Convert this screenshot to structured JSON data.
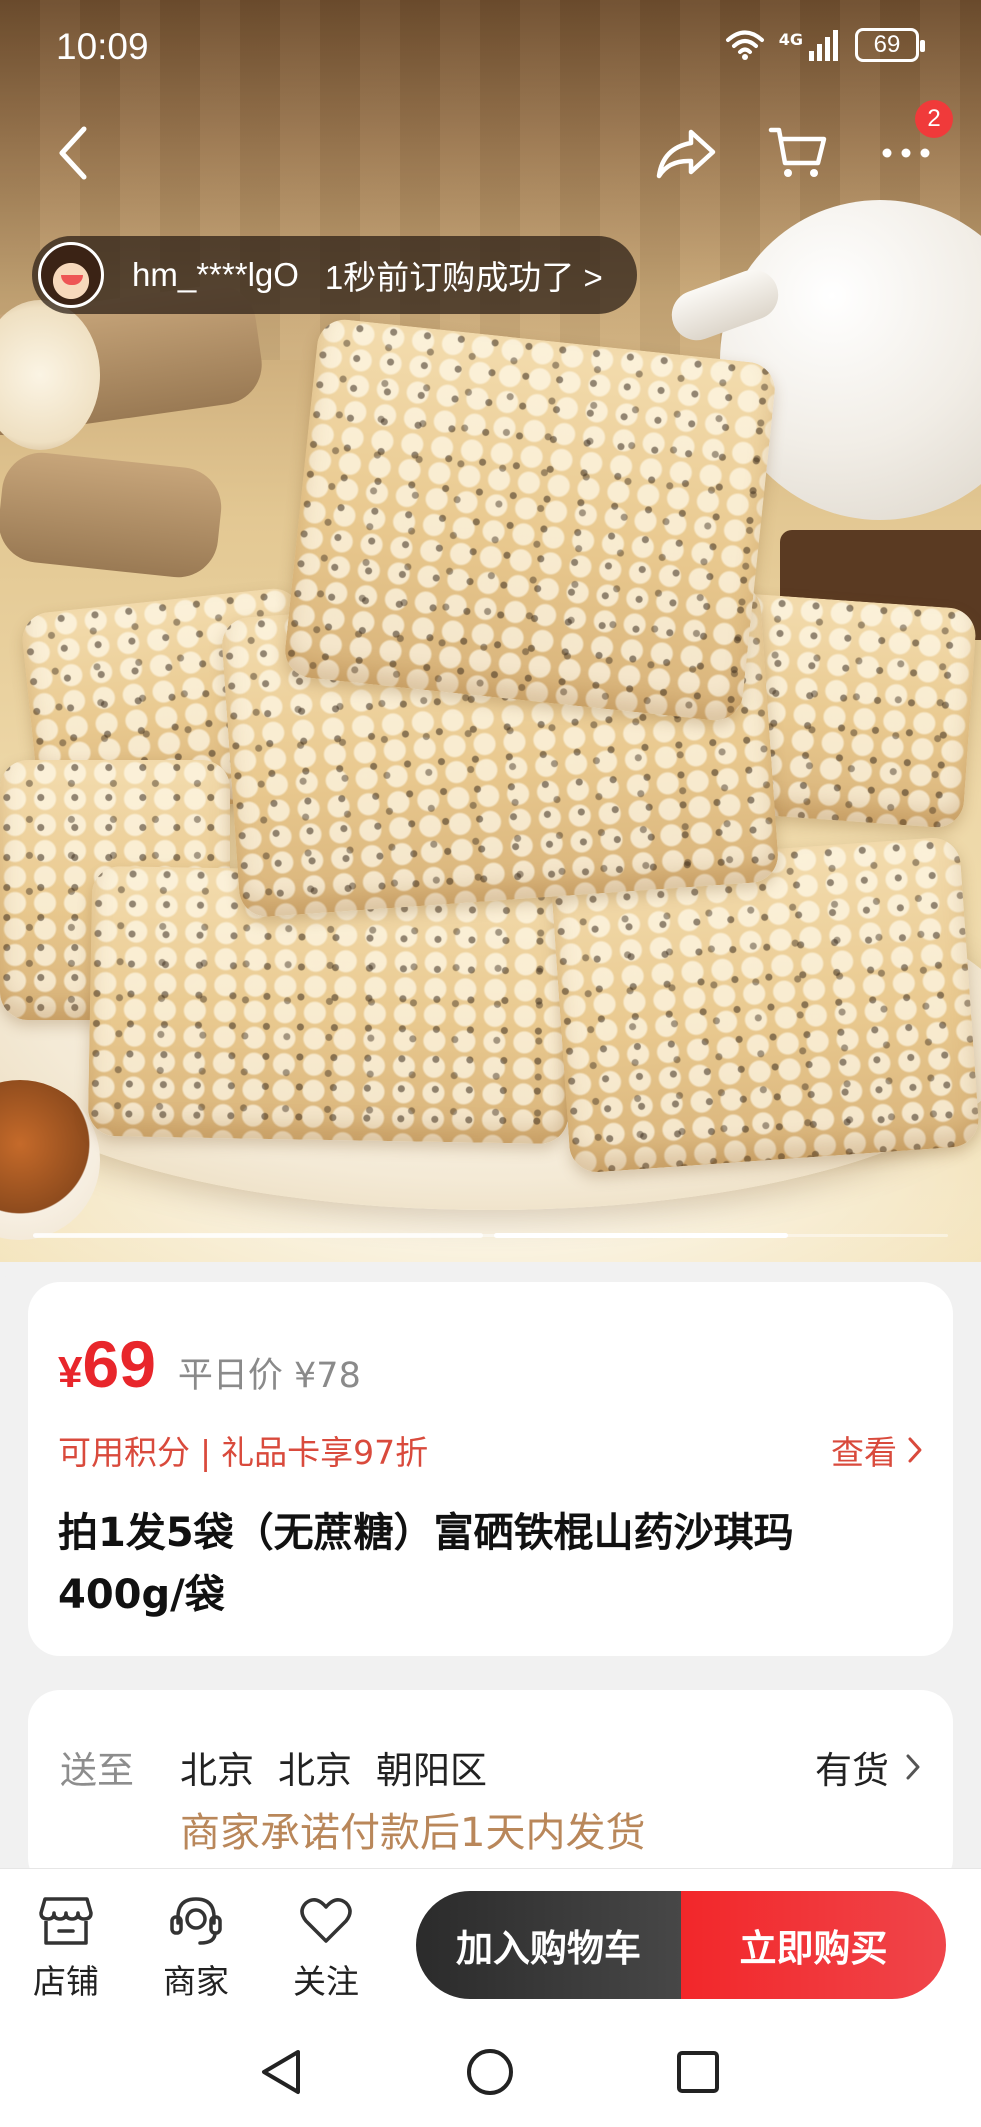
{
  "status_bar": {
    "time": "10:09",
    "network": "4G",
    "battery": "69"
  },
  "header": {
    "cart_badge": "2"
  },
  "ticker": {
    "user": "hm_****lgO",
    "message": "1秒前订购成功了 >"
  },
  "carousel": {
    "current_index": 2,
    "segments": 3
  },
  "product": {
    "price_symbol": "¥",
    "price": "69",
    "regular_price_label": "平日价 ¥78",
    "promo_points": "可用积分",
    "promo_separator": "|",
    "promo_giftcard": "礼品卡享97折",
    "view_label": "查看",
    "title": "拍1发5袋（无蔗糖）富硒铁棍山药沙琪玛400g/袋"
  },
  "shipping": {
    "label": "送至",
    "province": "北京",
    "city": "北京",
    "district": "朝阳区",
    "stock": "有货",
    "note": "商家承诺付款后1天内发货"
  },
  "actions": {
    "store": "店铺",
    "merchant": "商家",
    "follow": "关注",
    "add_to_cart": "加入购物车",
    "buy_now": "立即购买"
  },
  "colors": {
    "price_red": "#e8262b",
    "promo_red": "#d94a3c",
    "note_tan": "#b9875a",
    "buy_red": "#f2272a",
    "cart_dark": "#2b2b2b"
  }
}
